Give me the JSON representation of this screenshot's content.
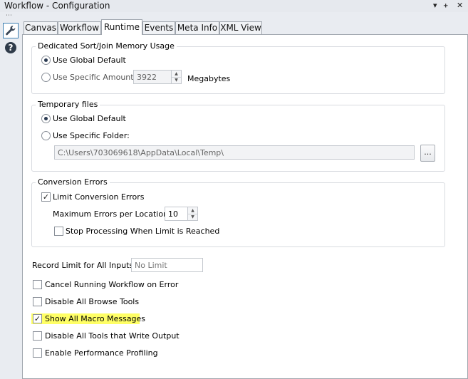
{
  "window": {
    "title": "Workflow - Configuration",
    "controls": {
      "dropdown": "▾",
      "pin": "ᚐ",
      "close": "✕"
    }
  },
  "sidebar": {
    "tool_icon": "wrench-icon",
    "help_icon": "help-icon",
    "help_glyph": "?"
  },
  "tabs": [
    {
      "label": "Canvas",
      "active": false
    },
    {
      "label": "Workflow",
      "active": false
    },
    {
      "label": "Runtime",
      "active": true
    },
    {
      "label": "Events",
      "active": false
    },
    {
      "label": "Meta Info",
      "active": false
    },
    {
      "label": "XML View",
      "active": false
    }
  ],
  "memory": {
    "legend": "Dedicated Sort/Join Memory Usage",
    "global_label": "Use Global Default",
    "specific_label": "Use Specific Amount:",
    "amount_value": "3922",
    "unit_label": "Megabytes",
    "selected": "global"
  },
  "temp": {
    "legend": "Temporary files",
    "global_label": "Use Global Default",
    "specific_label": "Use Specific Folder:",
    "folder_value": "C:\\Users\\703069618\\AppData\\Local\\Temp\\",
    "browse_label": "...",
    "selected": "global"
  },
  "conversion": {
    "legend": "Conversion Errors",
    "limit_label": "Limit Conversion Errors",
    "limit_checked": true,
    "max_label": "Maximum Errors per Location:",
    "max_value": "10",
    "stop_label": "Stop Processing When Limit is Reached",
    "stop_checked": false
  },
  "record_limit": {
    "label": "Record Limit for All Inputs:",
    "placeholder": "No Limit"
  },
  "options": [
    {
      "label": "Cancel Running Workflow on Error",
      "checked": false,
      "highlight": false
    },
    {
      "label": "Disable All Browse Tools",
      "checked": false,
      "highlight": false
    },
    {
      "label": "Show All Macro Messages",
      "checked": true,
      "highlight": true
    },
    {
      "label": "Disable All Tools that Write Output",
      "checked": false,
      "highlight": false
    },
    {
      "label": "Enable Performance Profiling",
      "checked": false,
      "highlight": false
    }
  ],
  "glyphs": {
    "check": "✓",
    "spin_up": "▲",
    "spin_down": "▼",
    "grip": "⋯"
  },
  "colors": {
    "highlight": "#ffff66",
    "active_border": "#3c7fb1"
  }
}
